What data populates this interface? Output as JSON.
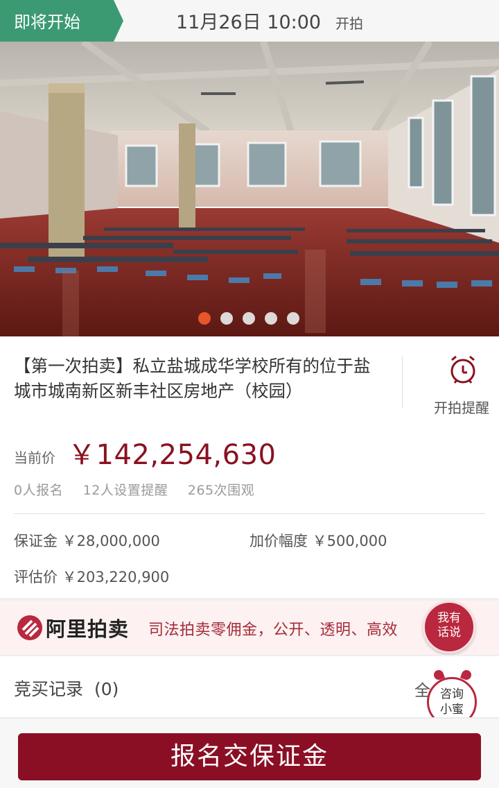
{
  "status": {
    "tag": "即将开始",
    "start_time": "11月26日  10:00",
    "start_suffix": "开拍"
  },
  "gallery": {
    "image": "school-canteen-interior-photo",
    "slide_count": 5,
    "active_index": 0
  },
  "item": {
    "title": "【第一次拍卖】私立盐城成华学校所有的位于盐城市城南新区新丰社区房地产（校园）",
    "reminder_label": "开拍提醒",
    "reminder_icon": "alarm-clock-icon",
    "price_label": "当前价",
    "price": "￥142,254,630",
    "signups": "0人报名",
    "reminders": "12人设置提醒",
    "views": "265次围观"
  },
  "details": {
    "deposit": "保证金 ￥28,000,000",
    "increment": "加价幅度 ￥500,000",
    "appraisal": "评估价 ￥203,220,900"
  },
  "banner": {
    "brand": "阿里拍卖",
    "slogan": "司法拍卖零佣金，公开、透明、高效",
    "chat_line1": "我有",
    "chat_line2": "话说"
  },
  "bids": {
    "label": "竞买记录",
    "count": "(0)",
    "all_link": "全",
    "consult_line1": "咨询",
    "consult_line2": "小蜜"
  },
  "cta": {
    "label": "报名交保证金"
  },
  "colors": {
    "status_tag": "#3c9a73",
    "price": "#8a1121",
    "cta_bg": "#8a0f25",
    "active_dot": "#ee5a2c"
  }
}
